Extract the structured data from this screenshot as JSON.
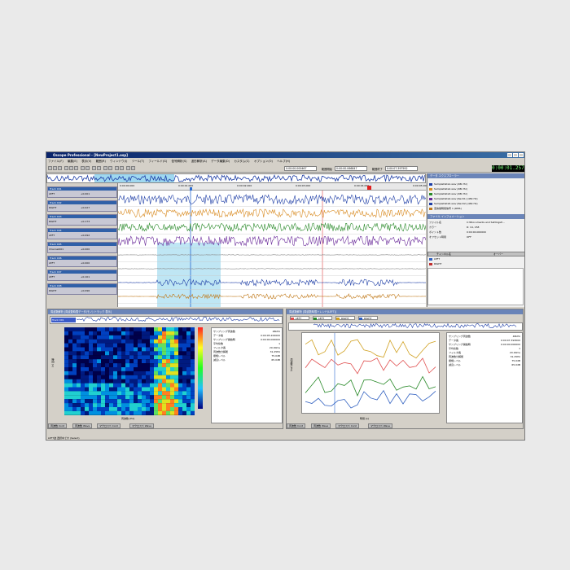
{
  "app": {
    "title": "Oscope Professional - [NewProject1.osp]",
    "lcd": "0:00:01.257"
  },
  "menu": [
    "ファイル(F)",
    "編集(E)",
    "表示(V)",
    "範囲(R)",
    "ウィンドウ(I)",
    "ツール(T)",
    "フィールド(G)",
    "信号解析(S)",
    "波形解析(A)",
    "データ編集(D)",
    "カスタム(C)",
    "オプション(O)",
    "ヘルプ(H)"
  ],
  "toolbar": {
    "field1": "0:00:00.000467",
    "label2": "範囲開始",
    "field2": "0:00:00.066847",
    "label3": "範囲終了",
    "field3": "0:00:07.397592"
  },
  "ruler": {
    "ticks": [
      "0:00:00.000",
      "0:00:01.000",
      "0:00:02.000",
      "0:00:03.000",
      "0:00:04.000",
      "0:00:05.000"
    ]
  },
  "tracks": [
    {
      "name": "Track 001",
      "ch": "LEFT",
      "unit": "Pa",
      "value": "+0.001",
      "color": "#1e3ea6"
    },
    {
      "name": "Track 002",
      "ch": "RIGHT",
      "unit": "Pa",
      "value": "+0.027",
      "color": "#d88a20"
    },
    {
      "name": "Track 003",
      "ch": "RIGHT",
      "unit": "Pa",
      "value": "+0.173",
      "color": "#2a8a2a"
    },
    {
      "name": "Track 004",
      "ch": "LEFT",
      "unit": "Pa",
      "value": "+0.092",
      "color": "#6a2a9a"
    },
    {
      "name": "Track 005",
      "ch": "Channel001",
      "unit": "Pa",
      "value": "+0.000",
      "color": "#1e3ea6"
    },
    {
      "name": "Track 006",
      "ch": "LEFT",
      "unit": "m/s2",
      "value": "+0.000",
      "color": "#1e3ea6"
    },
    {
      "name": "Track 007",
      "ch": "LEFT",
      "unit": "Pa",
      "value": "+0.101",
      "color": "#1e3ea6"
    },
    {
      "name": "Track 008",
      "ch": "RIGHT",
      "unit": "Pa",
      "value": "+0.096",
      "color": "#c07818"
    }
  ],
  "waveTicks": [
    "1.0",
    "0.5",
    "0",
    "-0.5",
    "-1.0"
  ],
  "rightPanel": {
    "explorerTitle": "データ エクスプローラー",
    "files": [
      {
        "label": "SampleData1.wav (48k Hz)",
        "color": "#1e3ea6"
      },
      {
        "label": "SampleData2.wav (48k Hz)",
        "color": "#d88a20"
      },
      {
        "label": "SampleData3.wav (48k Hz)",
        "color": "#2a8a2a"
      },
      {
        "label": "SampleData4.wav (Rec01) (48k Hz)",
        "color": "#6a2a9a"
      },
      {
        "label": "SampleData5.wav (Rec02) (48k Hz)",
        "color": "#1e3ea6"
      },
      {
        "label": "変換後時間信号 1 (RMS)",
        "color": "#c07818"
      }
    ],
    "infoTitle": "ファイル インフォメーション",
    "info": [
      {
        "k": "ファイル名",
        "v": "C:¥Documents and Settings¥..."
      },
      {
        "k": "カラー",
        "v": "R: 14, 158"
      },
      {
        "k": "ポイント数",
        "v": "0:00:00.000000"
      },
      {
        "k": "オフセット時間",
        "v": "OFF"
      }
    ],
    "chTable": {
      "col1": "チャンネル名",
      "col2": "オーバー",
      "rows": [
        {
          "n": "LEFT",
          "v": ""
        },
        {
          "n": "RIGHT",
          "v": ""
        }
      ]
    }
  },
  "paneLeft": {
    "title": "周波数解析 [周波数時間データ(モノ) トラック 表示]",
    "mini": "Track 001",
    "info": [
      {
        "k": "サンプリング周波数",
        "v": "48kHz"
      },
      {
        "k": "データ長",
        "v": "0:00:05.200000"
      },
      {
        "k": "サンプリング開始時",
        "v": "0:00:00.000000"
      },
      {
        "k": "平均化数",
        "v": "1"
      },
      {
        "k": "フィルタ長",
        "v": "20.00ms"
      },
      {
        "k": "周波数分解能",
        "v": "31.25Hz"
      },
      {
        "k": "振幅レベル",
        "v": "75.0dB"
      },
      {
        "k": "減衰レベル",
        "v": "65.0dB"
      }
    ],
    "xlabel": "周波数 [Hz]",
    "ylabel": "時間 [s]",
    "tabs": [
      "周波数 Cont",
      "周波数 Wave",
      "マクロスペ Cont",
      "マクロスペ Wave"
    ]
  },
  "paneRight": {
    "title": "周波数解析 [周波数時間トレンド(LEFT)]",
    "legend": [
      {
        "label": "LEFT",
        "color": "#e05050"
      },
      {
        "label": "LEFT",
        "color": "#2a8a2a"
      },
      {
        "label": "RIGHT",
        "color": "#d0a020"
      },
      {
        "label": "RIGHT",
        "color": "#3060c0"
      }
    ],
    "info": [
      {
        "k": "サンプリング周波数",
        "v": "48kHz"
      },
      {
        "k": "データ長",
        "v": "0:00:07.393000"
      },
      {
        "k": "サンプリング開始時",
        "v": "0:00:00.000000"
      },
      {
        "k": "平均化数",
        "v": "1"
      },
      {
        "k": "フィルタ長",
        "v": "20.00ms"
      },
      {
        "k": "周波数分解能",
        "v": "31.25Hz"
      },
      {
        "k": "振幅レベル",
        "v": "75.0dB"
      },
      {
        "k": "減衰レベル",
        "v": "65.0dB"
      }
    ],
    "xlabel": "時間 [s]",
    "ylabel": "周波数 [Hz]",
    "tabs": [
      "周波数 Cont",
      "周波数 Wave",
      "マクロスペ Cont",
      "マクロスペ Wave"
    ]
  },
  "status": "LEFT波 選択中です (Select)"
}
